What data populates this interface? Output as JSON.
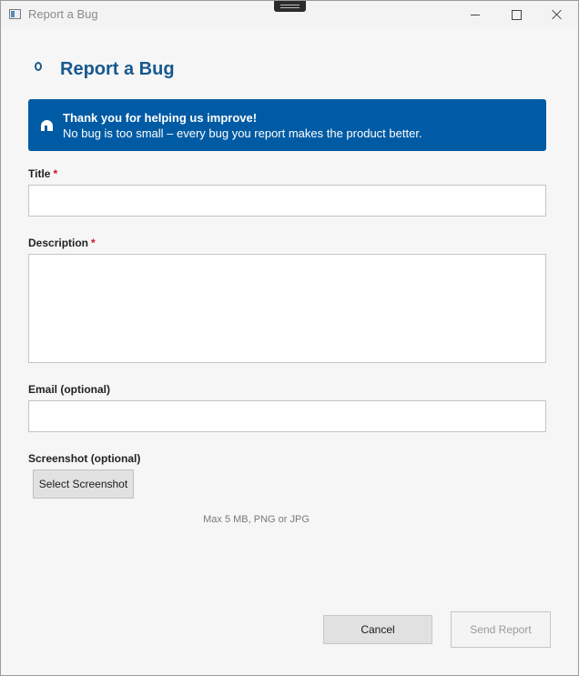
{
  "window": {
    "title": "Report a Bug"
  },
  "header": {
    "title": "Report a Bug"
  },
  "banner": {
    "title": "Thank you for helping us improve!",
    "text": "No bug is too small – every bug you report makes the product better."
  },
  "form": {
    "title": {
      "label": "Title",
      "required_mark": "*",
      "value": ""
    },
    "description": {
      "label": "Description",
      "required_mark": "*",
      "value": ""
    },
    "email": {
      "label": "Email (optional)",
      "value": ""
    },
    "screenshot": {
      "label": "Screenshot (optional)",
      "button_label": "Select Screenshot",
      "hint": "Max 5 MB, PNG or JPG"
    }
  },
  "actions": {
    "cancel_label": "Cancel",
    "send_label": "Send Report",
    "send_enabled": false
  },
  "colors": {
    "accent": "#005ba4",
    "title_text": "#17598f",
    "required": "#c8141e"
  },
  "icons": {
    "app": "app-window-icon",
    "header": "bug-ring-icon",
    "banner": "info-shape-icon",
    "minimize": "minimize-icon",
    "maximize": "maximize-icon",
    "close": "close-icon"
  }
}
